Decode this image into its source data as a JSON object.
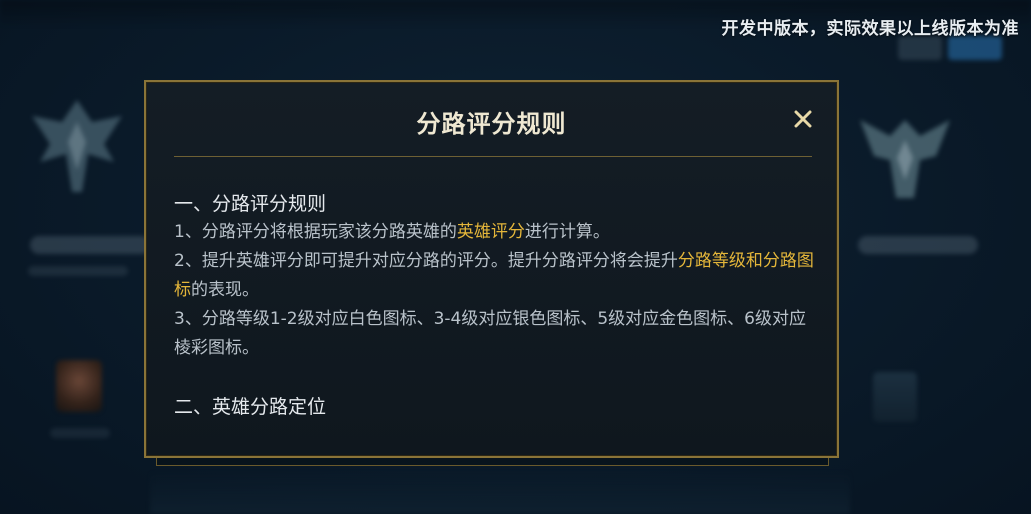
{
  "watermark": "开发中版本，实际效果以上线版本为准",
  "dialog": {
    "title": "分路评分规则",
    "close_icon": "close-icon",
    "section1": {
      "heading": "一、分路评分规则",
      "line1": {
        "prefix": "1、分路评分将根据玩家该分路英雄的",
        "highlight": "英雄评分",
        "suffix": "进行计算。"
      },
      "line2": {
        "prefix": "2、提升英雄评分即可提升对应分路的评分。提升分路评分将会提升",
        "highlight": "分路等级和分路图标",
        "suffix": "的表现。"
      },
      "line3": "3、分路等级1-2级对应白色图标、3-4级对应银色图标、5级对应金色图标、6级对应棱彩图标。"
    },
    "section2": {
      "heading": "二、英雄分路定位"
    }
  },
  "colors": {
    "highlight": "#e4b63a",
    "border_gold": "#8a7438",
    "dialog_bg": "#141d25",
    "page_bg": "#0a1a29"
  }
}
